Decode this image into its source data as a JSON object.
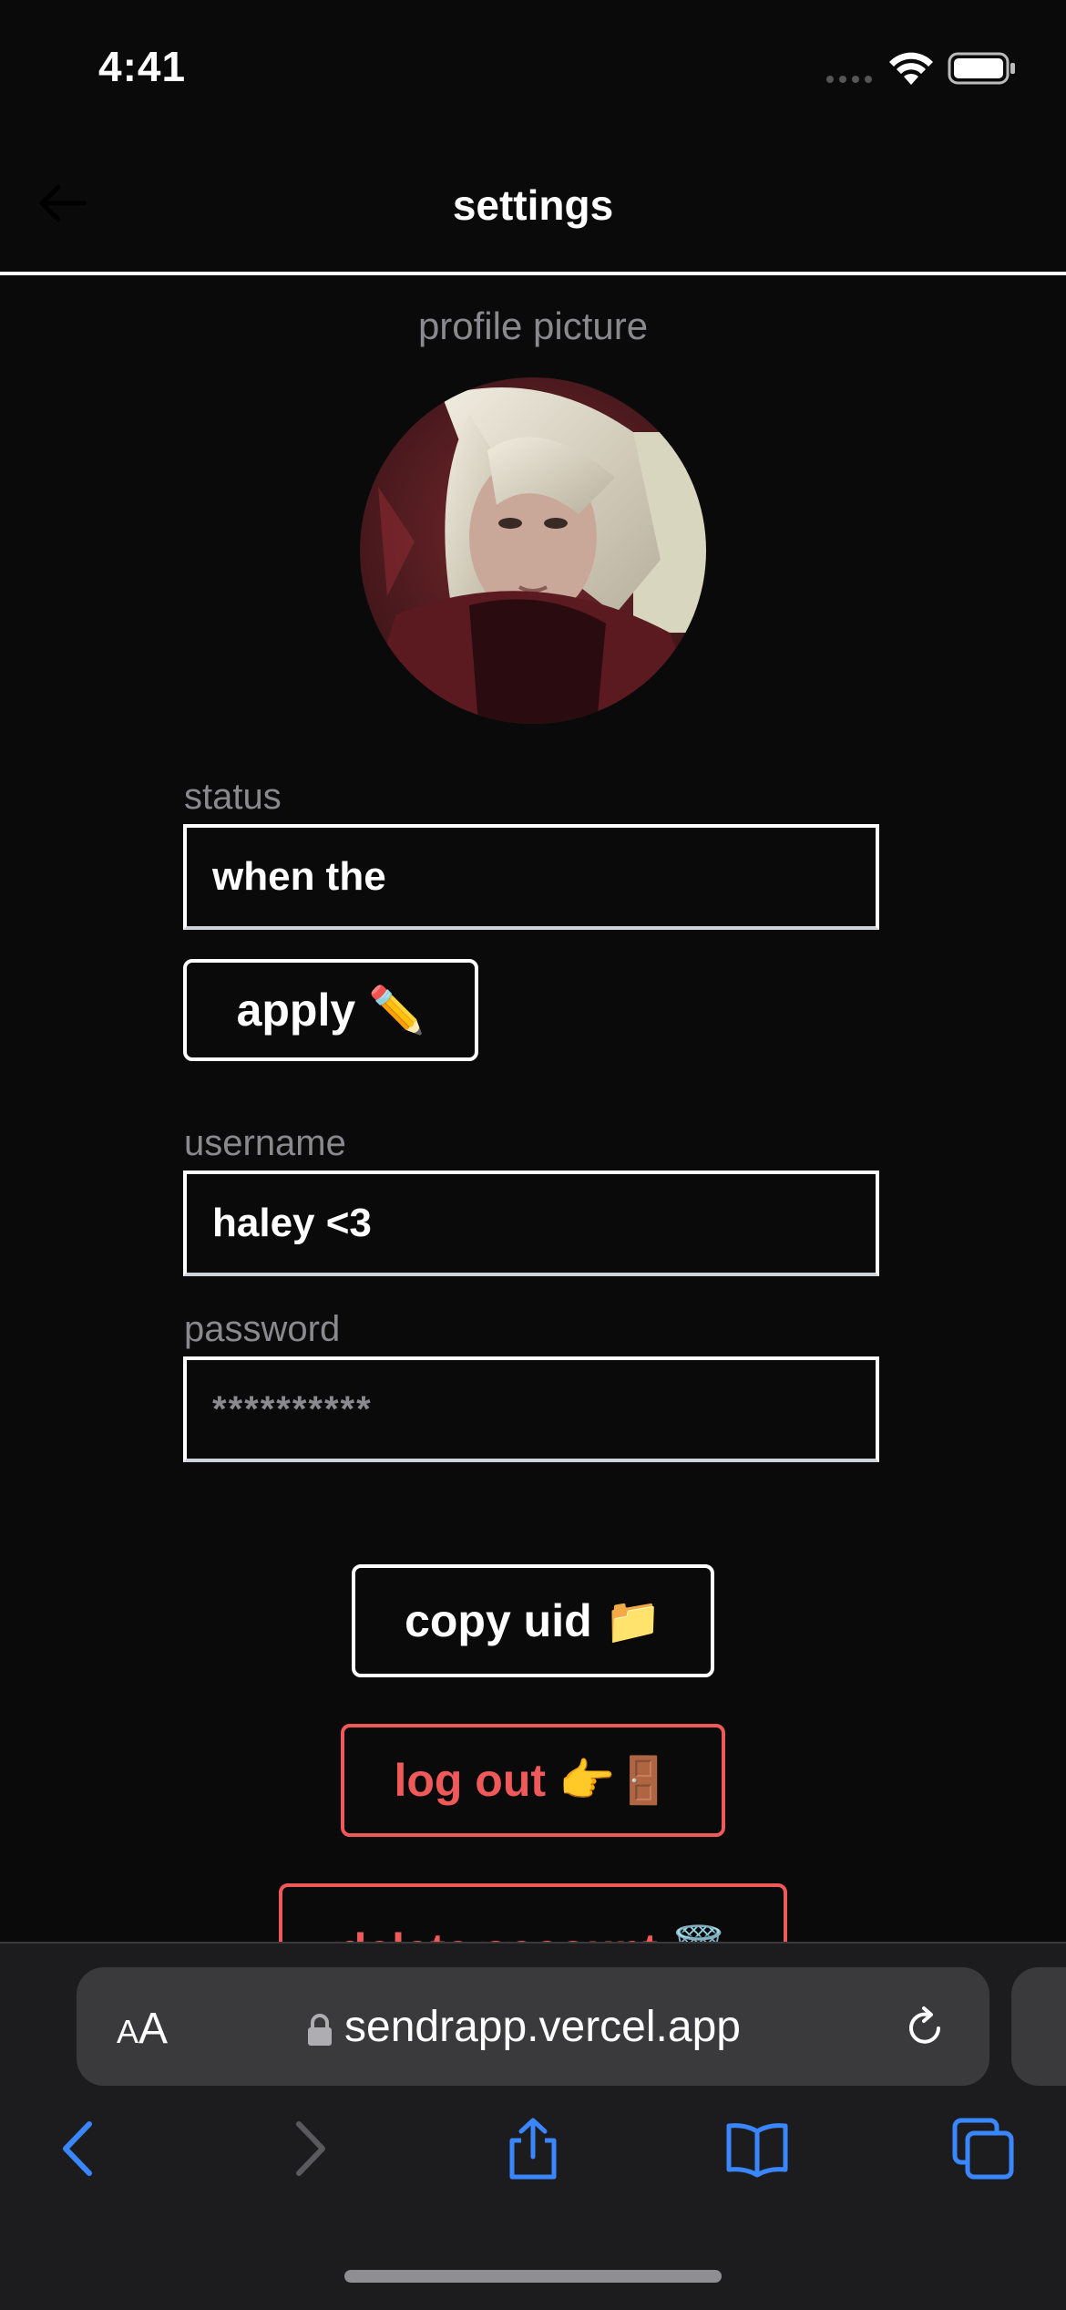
{
  "status_bar": {
    "time": "4:41"
  },
  "header": {
    "title": "settings"
  },
  "profile": {
    "picture_label": "profile picture"
  },
  "status": {
    "label": "status",
    "value": "when the",
    "apply_label": "apply",
    "apply_emoji": "✏️"
  },
  "username": {
    "label": "username",
    "value": "haley <3"
  },
  "password": {
    "label": "password",
    "value": "**********"
  },
  "actions": {
    "copy_uid_label": "copy uid",
    "copy_uid_emoji": "📁",
    "logout_label": "log out",
    "logout_emoji": "👉🚪",
    "delete_label": "delete account",
    "delete_emoji": "🗑️"
  },
  "browser": {
    "aa_small": "A",
    "aa_large": "A",
    "url": "sendrapp.vercel.app"
  },
  "colors": {
    "background": "#0a0a0b",
    "danger": "#ef5959",
    "accent_blue": "#3a86ff",
    "muted": "#8a8a8e"
  },
  "icons": [
    "back-arrow-icon",
    "wifi-icon",
    "battery-icon",
    "lock-icon",
    "reload-icon",
    "browser-back-icon",
    "browser-forward-icon",
    "share-icon",
    "bookmarks-icon",
    "tabs-icon"
  ]
}
